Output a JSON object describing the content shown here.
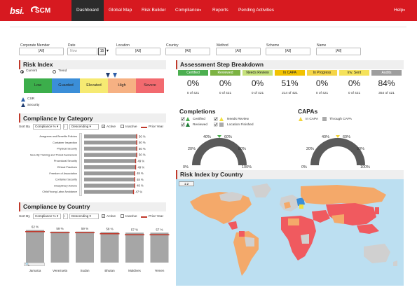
{
  "nav": {
    "logo_bsi": "bsi.",
    "logo_scm": "SCM",
    "items": [
      "Dashboard",
      "Global Map",
      "Risk Builder",
      "Compliance",
      "Reports",
      "Pending Activities"
    ],
    "help": "Help"
  },
  "filters": [
    {
      "label": "Corporate Member",
      "value": "[All]"
    },
    {
      "label": "Date",
      "value": "Now"
    },
    {
      "label": "Location",
      "value": "[All]"
    },
    {
      "label": "Country",
      "value": "[All]"
    },
    {
      "label": "Method",
      "value": "[All]"
    },
    {
      "label": "Scheme",
      "value": "[All]"
    },
    {
      "label": "Name",
      "value": "[All]"
    }
  ],
  "date_badge": "15",
  "risk_index": {
    "title": "Risk Index",
    "radio_current": "Current",
    "radio_trend": "Trend",
    "segments": [
      {
        "label": "Low",
        "color": "#3cae4b"
      },
      {
        "label": "Guarded",
        "color": "#3b8ed8"
      },
      {
        "label": "Elevated",
        "color": "#f6ea72"
      },
      {
        "label": "High",
        "color": "#f6b183"
      },
      {
        "label": "Severe",
        "color": "#f26a6f"
      }
    ],
    "legend": [
      "CSR",
      "Security"
    ]
  },
  "assessment": {
    "title": "Assessment Step Breakdown",
    "cards": [
      {
        "label": "Certified",
        "pct": "0%",
        "of": "0 of 421",
        "color": "#4caf50",
        "text": "#ffffff"
      },
      {
        "label": "Reviewed",
        "pct": "0%",
        "of": "0 of 421",
        "color": "#7cb342",
        "text": "#ffffff"
      },
      {
        "label": "Needs Review",
        "pct": "0%",
        "of": "0 of 421",
        "color": "#c5e17a",
        "text": "#222222"
      },
      {
        "label": "In CAPA",
        "pct": "51%",
        "of": "214 of 421",
        "color": "#f2c200",
        "text": "#222222"
      },
      {
        "label": "In Progress",
        "pct": "0%",
        "of": "0 of 421",
        "color": "#f5d547",
        "text": "#222222"
      },
      {
        "label": "Inv. Sent",
        "pct": "0%",
        "of": "0 of 421",
        "color": "#f5e25a",
        "text": "#222222"
      },
      {
        "label": "Audits",
        "pct": "84%",
        "of": "354 of 421",
        "color": "#9e9e9e",
        "text": "#ffffff"
      }
    ]
  },
  "completions": {
    "title": "Completions",
    "legend": [
      "Certified",
      "Needs Review",
      "Reviewed",
      "Location Finished"
    ],
    "ticks": [
      "0%",
      "20%",
      "40%",
      "60%",
      "80%",
      "100%"
    ]
  },
  "capas": {
    "title": "CAPAs",
    "legend": [
      "In CAPA",
      "Through CAPA"
    ],
    "ticks": [
      "0%",
      "20%",
      "40%",
      "60%",
      "80%",
      "100%"
    ]
  },
  "category": {
    "title": "Compliance by Category",
    "sort_by": "Sort By",
    "sort_field": "Compliance %",
    "sort_order": "Descending",
    "active": "Active",
    "inactive": "Inactive",
    "prior_year": "Prior Year"
  },
  "country": {
    "title": "Compliance by Country",
    "sort_by": "Sort By",
    "sort_field": "Compliance %",
    "sort_order": "Descending",
    "active": "Active",
    "inactive": "Inactive",
    "prior_year": "Prior Year"
  },
  "map": {
    "title": "Risk Index by Country",
    "zoom": "1:2"
  },
  "chart_data": [
    {
      "type": "bar",
      "title": "Compliance by Category",
      "orientation": "horizontal",
      "categories": [
        "Anagrams and Benefits Policies",
        "Container Inspection",
        "Physical Security",
        "Security Training and Threat Awareness",
        "Procedural Security",
        "Ethical Practices",
        "Freedom of Association",
        "Container Security",
        "Disciplinary Actions",
        "Child/Young Labor Avoidance"
      ],
      "values": [
        50,
        50,
        50,
        50,
        49,
        49,
        48,
        48,
        48,
        47
      ],
      "labels": [
        "50 %",
        "50 %",
        "50 %",
        "50 %",
        "49 %",
        "49 %",
        "48 %",
        "48 %",
        "48 %",
        "47 %"
      ],
      "prior_year": [
        50,
        50,
        50,
        50,
        49,
        49,
        48,
        48,
        48,
        47
      ],
      "xlim": [
        0,
        100
      ]
    },
    {
      "type": "bar",
      "title": "Compliance by Country",
      "categories": [
        "Jamaica",
        "Venezuela",
        "Sudan",
        "Bhutan",
        "Maldives",
        "Yemen"
      ],
      "values": [
        62,
        59,
        59,
        58,
        57,
        57
      ],
      "labels": [
        "62 %",
        "59 %",
        "59 %",
        "58 %",
        "57 %",
        "57 %"
      ],
      "prior_year": [
        59,
        57,
        57,
        55,
        53,
        53
      ],
      "ylim": [
        0,
        80
      ]
    }
  ]
}
